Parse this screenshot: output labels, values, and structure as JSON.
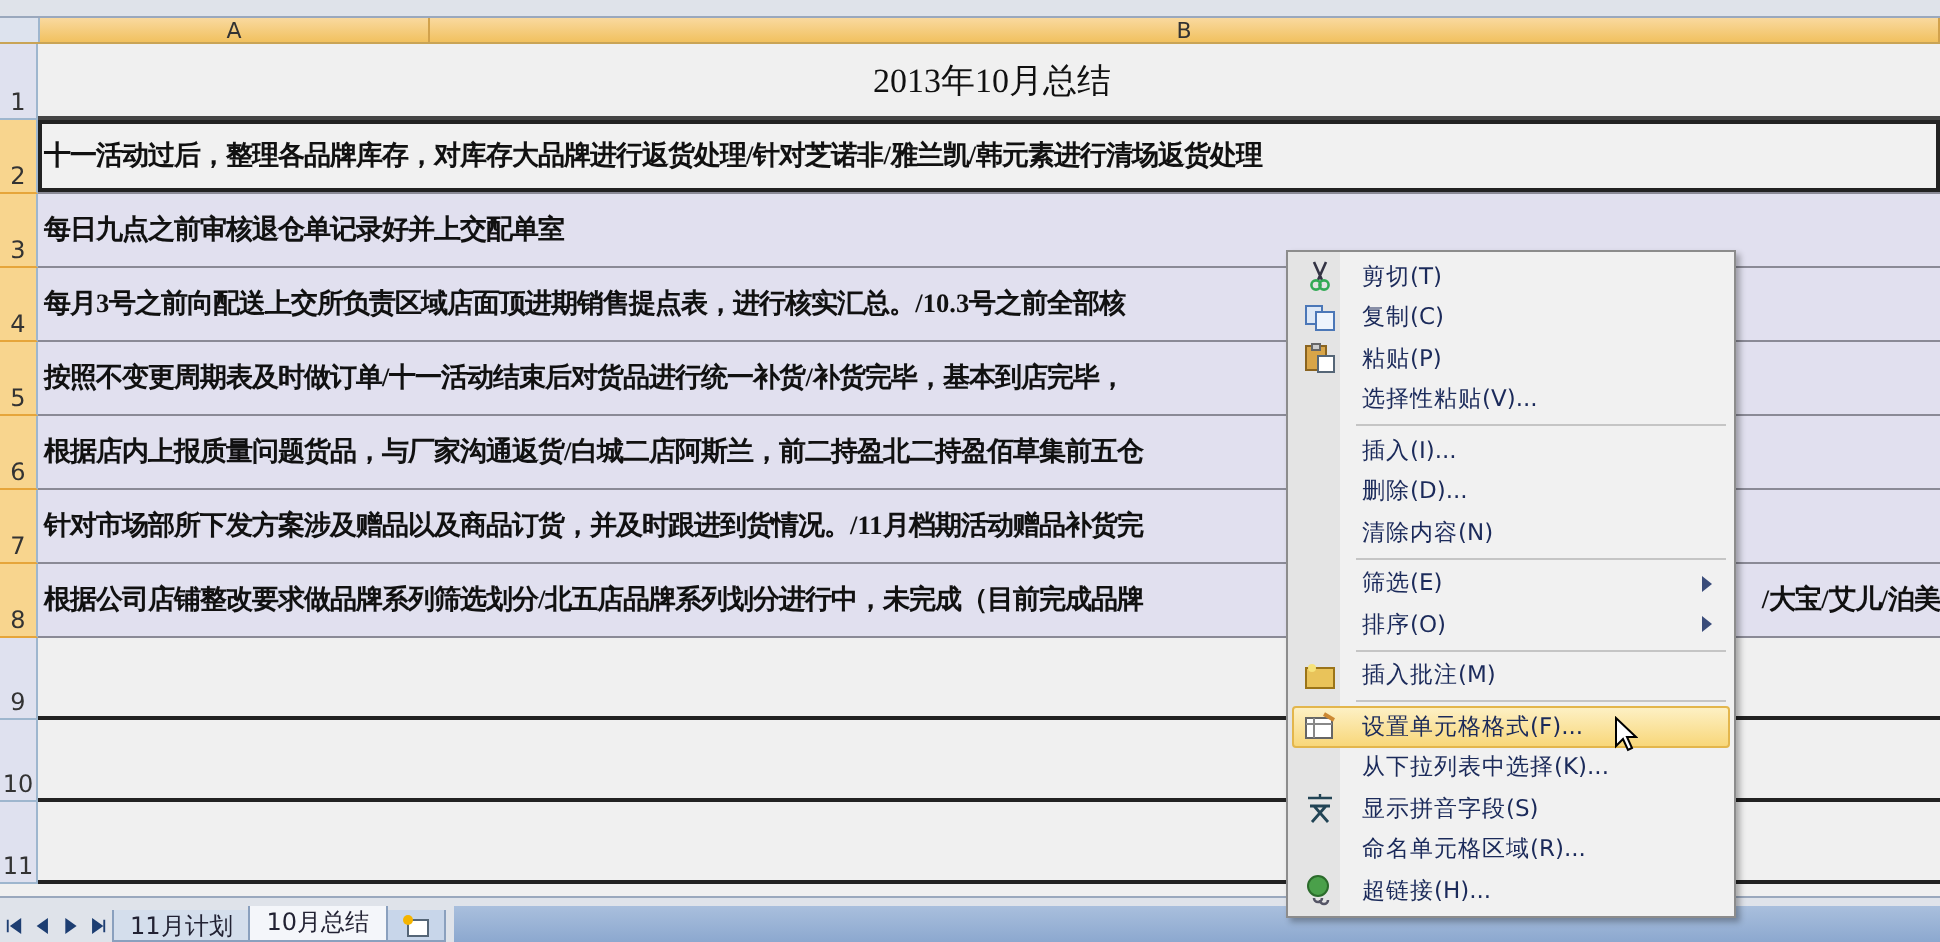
{
  "column_headers": [
    {
      "label": "A",
      "selected": true
    },
    {
      "label": "B",
      "selected": true
    }
  ],
  "rows": [
    {
      "number": "1",
      "kind": "title",
      "text": "2013年10月总结",
      "selected": false,
      "active": false
    },
    {
      "number": "2",
      "kind": "text",
      "text": "十一活动过后，整理各品牌库存，对库存大品牌进行返货处理/针对芝诺非/雅兰凯/韩元素进行清场返货处理",
      "selected": true,
      "active": true
    },
    {
      "number": "3",
      "kind": "text",
      "text": "每日九点之前审核退仓单记录好并上交配单室",
      "selected": true,
      "active": false
    },
    {
      "number": "4",
      "kind": "text",
      "text": "每月3号之前向配送上交所负责区域店面顶进期销售提点表，进行核实汇总。/10.3号之前全部核",
      "selected": true,
      "active": false
    },
    {
      "number": "5",
      "kind": "text",
      "text": "按照不变更周期表及时做订单/十一活动结束后对货品进行统一补货/补货完毕，基本到店完毕，",
      "selected": true,
      "active": false
    },
    {
      "number": "6",
      "kind": "text",
      "text": "根据店内上报质量问题货品，与厂家沟通返货/白城二店阿斯兰，前二持盈北二持盈佰草集前五仓",
      "selected": true,
      "active": false
    },
    {
      "number": "7",
      "kind": "text",
      "text": "针对市场部所下发方案涉及赠品以及商品订货，并及时跟进到货情况。/11月档期活动赠品补货完",
      "selected": true,
      "active": false
    },
    {
      "number": "8",
      "kind": "text",
      "text": "根据公司店铺整改要求做品牌系列筛选划分/北五店品牌系列划分进行中，未完成（目前完成品牌",
      "text_right": "/大宝/艾儿/泊美",
      "selected": true,
      "active": false
    },
    {
      "number": "9",
      "kind": "empty",
      "selected": false,
      "active": false
    },
    {
      "number": "10",
      "kind": "empty",
      "selected": false,
      "active": false
    },
    {
      "number": "11",
      "kind": "empty",
      "selected": false,
      "active": false
    }
  ],
  "context_menu": [
    {
      "kind": "item",
      "label": "剪切(T)",
      "submenu": false,
      "selected": false
    },
    {
      "kind": "item",
      "label": "复制(C)",
      "submenu": false,
      "selected": false
    },
    {
      "kind": "item",
      "label": "粘贴(P)",
      "submenu": false,
      "selected": false
    },
    {
      "kind": "item",
      "label": "选择性粘贴(V)...",
      "submenu": false,
      "selected": false
    },
    {
      "kind": "separator"
    },
    {
      "kind": "item",
      "label": "插入(I)...",
      "submenu": false,
      "selected": false
    },
    {
      "kind": "item",
      "label": "删除(D)...",
      "submenu": false,
      "selected": false
    },
    {
      "kind": "item",
      "label": "清除内容(N)",
      "submenu": false,
      "selected": false
    },
    {
      "kind": "separator"
    },
    {
      "kind": "item",
      "label": "筛选(E)",
      "submenu": true,
      "selected": false
    },
    {
      "kind": "item",
      "label": "排序(O)",
      "submenu": true,
      "selected": false
    },
    {
      "kind": "separator"
    },
    {
      "kind": "item",
      "label": "插入批注(M)",
      "submenu": false,
      "selected": false
    },
    {
      "kind": "separator"
    },
    {
      "kind": "item",
      "label": "设置单元格格式(F)...",
      "submenu": false,
      "selected": true
    },
    {
      "kind": "item",
      "label": "从下拉列表中选择(K)...",
      "submenu": false,
      "selected": false
    },
    {
      "kind": "item",
      "label": "显示拼音字段(S)",
      "submenu": false,
      "selected": false
    },
    {
      "kind": "item",
      "label": "命名单元格区域(R)...",
      "submenu": false,
      "selected": false
    },
    {
      "kind": "item",
      "label": "超链接(H)...",
      "submenu": false,
      "selected": false
    }
  ],
  "sheet_tabs": [
    {
      "label": "11月计划",
      "selected": false
    },
    {
      "label": "10月总结",
      "selected": true
    }
  ]
}
